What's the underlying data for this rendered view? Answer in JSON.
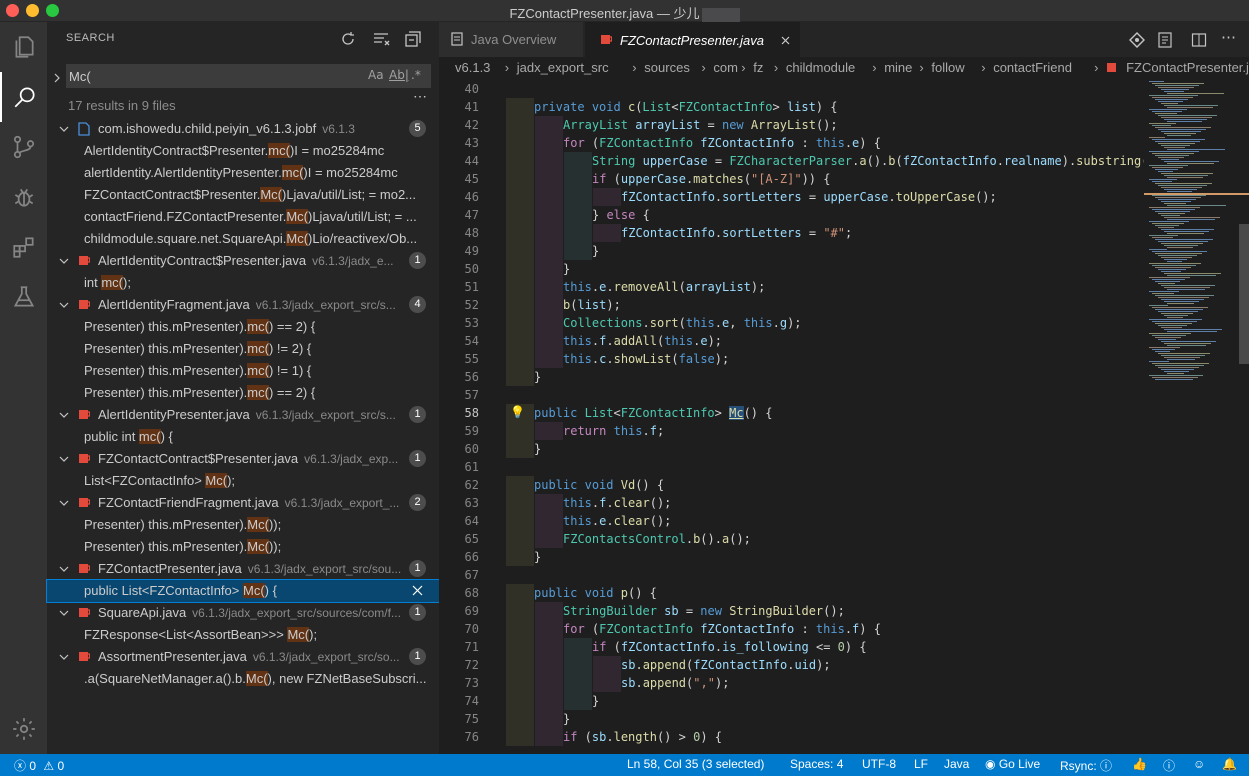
{
  "window": {
    "title": "FZContactPresenter.java — 少儿"
  },
  "sidebar": {
    "title": "SEARCH",
    "query": "Mc(",
    "summary": "17 results in 9 files",
    "options": [
      "Aa",
      "Ab|",
      ".*"
    ],
    "results": [
      {
        "kind": "file",
        "name": "com.ishowedu.child.peiyin_v6.1.3.jobf",
        "path": "v6.1.3",
        "count": "5",
        "icon": "file-icon"
      },
      {
        "kind": "match",
        "pre": "AlertIdentityContract$Presenter.",
        "hit": "mc(",
        "post": ")I = mo25284mc"
      },
      {
        "kind": "match",
        "pre": "alertIdentity.AlertIdentityPresenter.",
        "hit": "mc(",
        "post": ")I = mo25284mc"
      },
      {
        "kind": "match",
        "pre": "FZContactContract$Presenter.",
        "hit": "Mc(",
        "post": ")Ljava/util/List; = mo2..."
      },
      {
        "kind": "match",
        "pre": "contactFriend.FZContactPresenter.",
        "hit": "Mc(",
        "post": ")Ljava/util/List; = ..."
      },
      {
        "kind": "match",
        "pre": "childmodule.square.net.SquareApi.",
        "hit": "Mc(",
        "post": ")Lio/reactivex/Ob..."
      },
      {
        "kind": "file",
        "name": "AlertIdentityContract$Presenter.java",
        "path": "v6.1.3/jadx_e...",
        "count": "1",
        "icon": "java-icon"
      },
      {
        "kind": "match",
        "pre": "int ",
        "hit": "mc(",
        "post": ");"
      },
      {
        "kind": "file",
        "name": "AlertIdentityFragment.java",
        "path": "v6.1.3/jadx_export_src/s...",
        "count": "4",
        "icon": "java-icon"
      },
      {
        "kind": "match",
        "pre": "Presenter) this.mPresenter).",
        "hit": "mc(",
        "post": ") == 2) {"
      },
      {
        "kind": "match",
        "pre": "Presenter) this.mPresenter).",
        "hit": "mc(",
        "post": ") != 2) {"
      },
      {
        "kind": "match",
        "pre": "Presenter) this.mPresenter).",
        "hit": "mc(",
        "post": ") != 1) {"
      },
      {
        "kind": "match",
        "pre": "Presenter) this.mPresenter).",
        "hit": "mc(",
        "post": ") == 2) {"
      },
      {
        "kind": "file",
        "name": "AlertIdentityPresenter.java",
        "path": "v6.1.3/jadx_export_src/s...",
        "count": "1",
        "icon": "java-icon"
      },
      {
        "kind": "match",
        "pre": "public int ",
        "hit": "mc(",
        "post": ") {"
      },
      {
        "kind": "file",
        "name": "FZContactContract$Presenter.java",
        "path": "v6.1.3/jadx_exp...",
        "count": "1",
        "icon": "java-icon"
      },
      {
        "kind": "match",
        "pre": "List<FZContactInfo> ",
        "hit": "Mc(",
        "post": ");"
      },
      {
        "kind": "file",
        "name": "FZContactFriendFragment.java",
        "path": "v6.1.3/jadx_export_...",
        "count": "2",
        "icon": "java-icon"
      },
      {
        "kind": "match",
        "pre": "Presenter) this.mPresenter).",
        "hit": "Mc(",
        "post": "));"
      },
      {
        "kind": "match",
        "pre": "Presenter) this.mPresenter).",
        "hit": "Mc(",
        "post": "));"
      },
      {
        "kind": "file",
        "name": "FZContactPresenter.java",
        "path": "v6.1.3/jadx_export_src/sou...",
        "count": "1",
        "icon": "java-icon"
      },
      {
        "kind": "match",
        "pre": "public List<FZContactInfo> ",
        "hit": "Mc(",
        "post": ") {",
        "selected": true
      },
      {
        "kind": "file",
        "name": "SquareApi.java",
        "path": "v6.1.3/jadx_export_src/sources/com/f...",
        "count": "1",
        "icon": "java-icon"
      },
      {
        "kind": "match",
        "pre": "FZResponse<List<AssortBean>>> ",
        "hit": "Mc(",
        "post": ");"
      },
      {
        "kind": "file",
        "name": "AssortmentPresenter.java",
        "path": "v6.1.3/jadx_export_src/so...",
        "count": "1",
        "icon": "java-icon"
      },
      {
        "kind": "match",
        "pre": ".a(SquareNetManager.a().b.",
        "hit": "Mc(",
        "post": "), new FZNetBaseSubscri..."
      }
    ]
  },
  "tabs": [
    {
      "label": "Java Overview",
      "active": false
    },
    {
      "label": "FZContactPresenter.java",
      "active": true
    }
  ],
  "breadcrumb": [
    "v6.1.3",
    "jadx_export_src",
    "sources",
    "com",
    "fz",
    "childmodule",
    "mine",
    "follow",
    "contactFriend",
    "FZContactPresenter.java"
  ],
  "editor": {
    "current_line": 58,
    "lines": [
      {
        "n": "40",
        "indent": 0,
        "code": ""
      },
      {
        "n": "41",
        "indent": 1,
        "code": "<span class='k'>private</span> <span class='k'>void</span> <span class='f'>c</span>(<span class='t'>List</span>&lt;<span class='t'>FZContactInfo</span>&gt; <span class='v'>list</span>) {"
      },
      {
        "n": "42",
        "indent": 2,
        "code": "<span class='t'>ArrayList</span> <span class='v'>arrayList</span> = <span class='k'>new</span> <span class='f'>ArrayList</span>();"
      },
      {
        "n": "43",
        "indent": 2,
        "code": "<span class='c'>for</span> (<span class='t'>FZContactInfo</span> <span class='v'>fZContactInfo</span> : <span class='k'>this</span>.<span class='v'>e</span>) {"
      },
      {
        "n": "44",
        "indent": 3,
        "code": "<span class='t'>String</span> <span class='v'>upperCase</span> = <span class='t'>FZCharacterParser</span>.<span class='f'>a</span>().<span class='f'>b</span>(<span class='v'>fZContactInfo</span>.<span class='v'>realname</span>).<span class='f'>substring</span>("
      },
      {
        "n": "45",
        "indent": 3,
        "code": "<span class='c'>if</span> (<span class='v'>upperCase</span>.<span class='f'>matches</span>(<span class='s'>\"[A-Z]\"</span>)) {"
      },
      {
        "n": "46",
        "indent": 4,
        "code": "<span class='v'>fZContactInfo</span>.<span class='v'>sortLetters</span> = <span class='v'>upperCase</span>.<span class='f'>toUpperCase</span>();"
      },
      {
        "n": "47",
        "indent": 3,
        "code": "} <span class='c'>else</span> {"
      },
      {
        "n": "48",
        "indent": 4,
        "code": "<span class='v'>fZContactInfo</span>.<span class='v'>sortLetters</span> = <span class='s'>\"#\"</span>;"
      },
      {
        "n": "49",
        "indent": 3,
        "code": "}"
      },
      {
        "n": "50",
        "indent": 2,
        "code": "}"
      },
      {
        "n": "51",
        "indent": 2,
        "code": "<span class='k'>this</span>.<span class='v'>e</span>.<span class='f'>removeAll</span>(<span class='v'>arrayList</span>);"
      },
      {
        "n": "52",
        "indent": 2,
        "code": "<span class='f'>b</span>(<span class='v'>list</span>);"
      },
      {
        "n": "53",
        "indent": 2,
        "code": "<span class='t'>Collections</span>.<span class='f'>sort</span>(<span class='k'>this</span>.<span class='v'>e</span>, <span class='k'>this</span>.<span class='v'>g</span>);"
      },
      {
        "n": "54",
        "indent": 2,
        "code": "<span class='k'>this</span>.<span class='v'>f</span>.<span class='f'>addAll</span>(<span class='k'>this</span>.<span class='v'>e</span>);"
      },
      {
        "n": "55",
        "indent": 2,
        "code": "<span class='k'>this</span>.<span class='v'>c</span>.<span class='f'>showList</span>(<span class='k'>false</span>);"
      },
      {
        "n": "56",
        "indent": 1,
        "code": "}"
      },
      {
        "n": "57",
        "indent": 0,
        "code": ""
      },
      {
        "n": "58",
        "indent": 1,
        "code": "<span class='k'>public</span> <span class='t'>List</span>&lt;<span class='t'>FZContactInfo</span>&gt; <span class='f' style='background:#264f78;text-decoration:underline'>Mc</span>() {"
      },
      {
        "n": "59",
        "indent": 2,
        "code": "<span class='c'>return</span> <span class='k'>this</span>.<span class='v'>f</span>;"
      },
      {
        "n": "60",
        "indent": 1,
        "code": "}"
      },
      {
        "n": "61",
        "indent": 0,
        "code": ""
      },
      {
        "n": "62",
        "indent": 1,
        "code": "<span class='k'>public</span> <span class='k'>void</span> <span class='f'>Vd</span>() {"
      },
      {
        "n": "63",
        "indent": 2,
        "code": "<span class='k'>this</span>.<span class='v'>f</span>.<span class='f'>clear</span>();"
      },
      {
        "n": "64",
        "indent": 2,
        "code": "<span class='k'>this</span>.<span class='v'>e</span>.<span class='f'>clear</span>();"
      },
      {
        "n": "65",
        "indent": 2,
        "code": "<span class='t'>FZContactsControl</span>.<span class='f'>b</span>().<span class='f'>a</span>();"
      },
      {
        "n": "66",
        "indent": 1,
        "code": "}"
      },
      {
        "n": "67",
        "indent": 0,
        "code": ""
      },
      {
        "n": "68",
        "indent": 1,
        "code": "<span class='k'>public</span> <span class='k'>void</span> <span class='f'>p</span>() {"
      },
      {
        "n": "69",
        "indent": 2,
        "code": "<span class='t'>StringBuilder</span> <span class='v'>sb</span> = <span class='k'>new</span> <span class='f'>StringBuilder</span>();"
      },
      {
        "n": "70",
        "indent": 2,
        "code": "<span class='c'>for</span> (<span class='t'>FZContactInfo</span> <span class='v'>fZContactInfo</span> : <span class='k'>this</span>.<span class='v'>f</span>) {"
      },
      {
        "n": "71",
        "indent": 3,
        "code": "<span class='c'>if</span> (<span class='v'>fZContactInfo</span>.<span class='v'>is_following</span> &lt;= <span class='n'>0</span>) {"
      },
      {
        "n": "72",
        "indent": 4,
        "code": "<span class='v'>sb</span>.<span class='f'>append</span>(<span class='v'>fZContactInfo</span>.<span class='v'>uid</span>);"
      },
      {
        "n": "73",
        "indent": 4,
        "code": "<span class='v'>sb</span>.<span class='f'>append</span>(<span class='s'>\",\"</span>);"
      },
      {
        "n": "74",
        "indent": 3,
        "code": "}"
      },
      {
        "n": "75",
        "indent": 2,
        "code": "}"
      },
      {
        "n": "76",
        "indent": 2,
        "code": "<span class='c'>if</span> (<span class='v'>sb</span>.<span class='f'>length</span>() &gt; <span class='n'>0</span>) {"
      }
    ]
  },
  "status": {
    "errors": "0",
    "warnings": "0",
    "cursor": "Ln 58, Col 35 (3 selected)",
    "spaces": "Spaces: 4",
    "encoding": "UTF-8",
    "eol": "LF",
    "language": "Java",
    "golive": "Go Live",
    "rsync": "Rsync:"
  }
}
